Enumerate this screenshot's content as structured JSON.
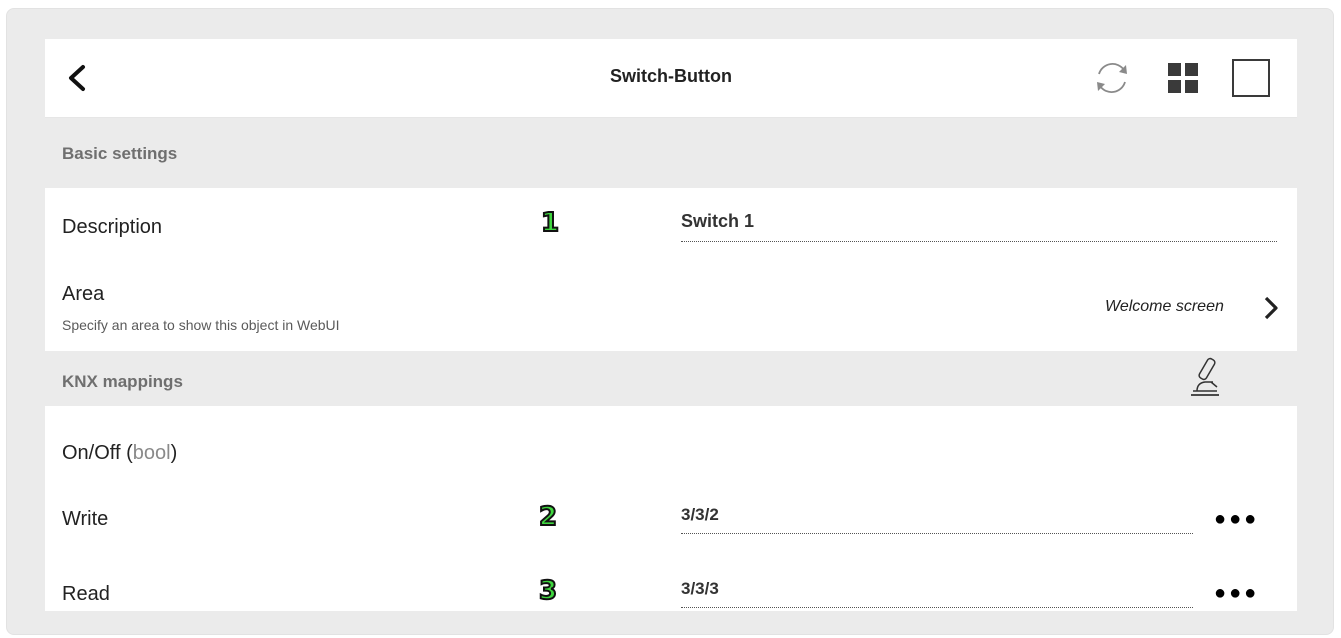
{
  "header": {
    "title": "Switch-Button",
    "icons": [
      "back-chevron-icon",
      "refresh-icon",
      "grid-view-icon",
      "single-view-icon"
    ]
  },
  "basic_settings": {
    "heading": "Basic settings",
    "description": {
      "label": "Description",
      "badge": "1",
      "value": "Switch 1"
    },
    "area": {
      "label": "Area",
      "sublabel": "Specify an area to show this object in WebUI",
      "value": "Welcome screen"
    }
  },
  "knx_mappings": {
    "heading": "KNX mappings",
    "icon": "microscope-icon",
    "onoff": {
      "label": "On/Off",
      "paren_open": "(",
      "type": "bool",
      "paren_close": ")"
    },
    "write": {
      "label": "Write",
      "badge": "2",
      "value": "3/3/2",
      "more": "●●●"
    },
    "read": {
      "label": "Read",
      "badge": "3",
      "value": "3/3/3",
      "more": "●●●"
    }
  },
  "colors": {
    "background": "#ebebeb",
    "panel": "#ffffff",
    "section": "#ebebeb",
    "badge_fill": "#3fd63f"
  }
}
